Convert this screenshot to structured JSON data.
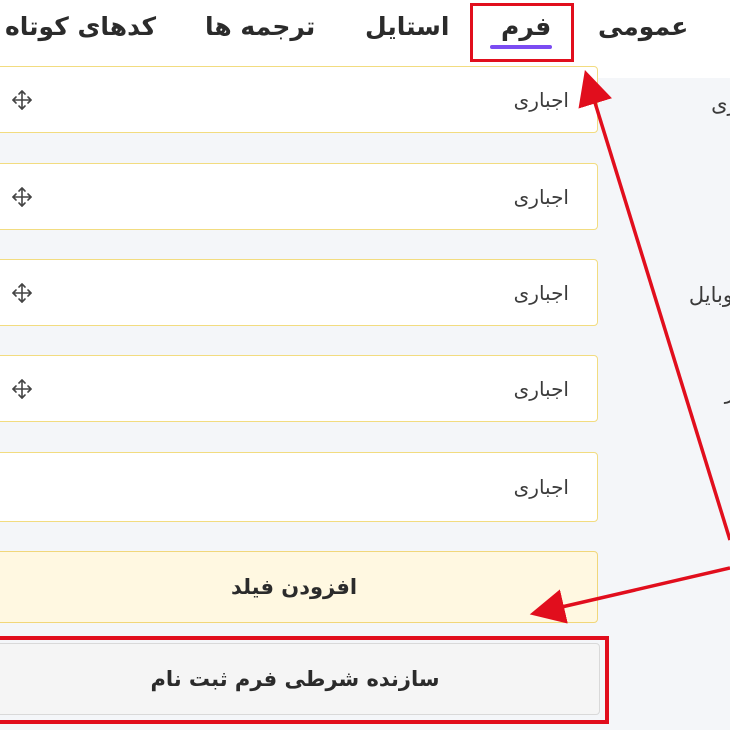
{
  "tabs": {
    "general": "عمومی",
    "form": "فرم",
    "style": "استایل",
    "translations": "ترجمه ها",
    "shortcodes": "کدهای کوتاه"
  },
  "fields": [
    {
      "label": "بری",
      "required_label": "اجباری",
      "has_move_handle": true
    },
    {
      "label": "",
      "required_label": "اجباری",
      "has_move_handle": true
    },
    {
      "label": "موبایل",
      "required_label": "اجباری",
      "has_move_handle": true
    },
    {
      "label": "ور",
      "required_label": "اجباری",
      "has_move_handle": true
    },
    {
      "label": "",
      "required_label": "اجباری",
      "has_move_handle": false
    }
  ],
  "actions": {
    "add_field": "افزودن فیلد",
    "conditional_builder": "سازنده شرطی فرم ثبت نام"
  },
  "colors": {
    "active_tab_underline": "#7b4cf2",
    "highlight_red": "#e10e1d",
    "field_border": "#f2dc80",
    "add_button_bg": "#fff8e1"
  },
  "icons": {
    "move_handle": "move-icon"
  }
}
